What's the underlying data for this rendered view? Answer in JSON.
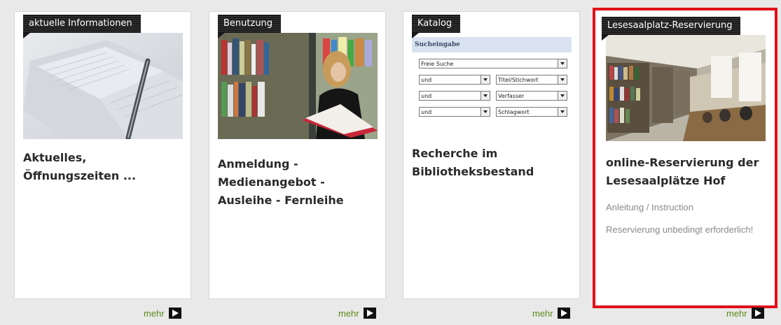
{
  "cards": [
    {
      "tag": "aktuelle Informationen",
      "title": "Aktuelles, Öffnungszeiten ...",
      "more": "mehr"
    },
    {
      "tag": "Benutzung",
      "title": "Anmeldung - Medienangebot - Ausleihe - Fernleihe",
      "more": "mehr"
    },
    {
      "tag": "Katalog",
      "title": "Recherche im Bibliotheksbestand",
      "more": "mehr",
      "form": {
        "heading": "Sucheingabe",
        "field1": "Freie Suche",
        "rows": [
          {
            "op": "und",
            "field": "Titel/Stichwort"
          },
          {
            "op": "und",
            "field": "Verfasser"
          },
          {
            "op": "und",
            "field": "Schlagwort"
          }
        ]
      }
    },
    {
      "tag": "Lesesaalplatz-Reservierung",
      "title": "online-Reservierung der Lesesaalplätze Hof",
      "line1": "Anleitung / Instruction",
      "line2": "Reservierung unbedingt erforderlich!",
      "more": "mehr"
    }
  ],
  "colors": {
    "highlight": "#e0111b",
    "more_link": "#5a8a1a",
    "form_head_bg": "#d8e3ef"
  }
}
